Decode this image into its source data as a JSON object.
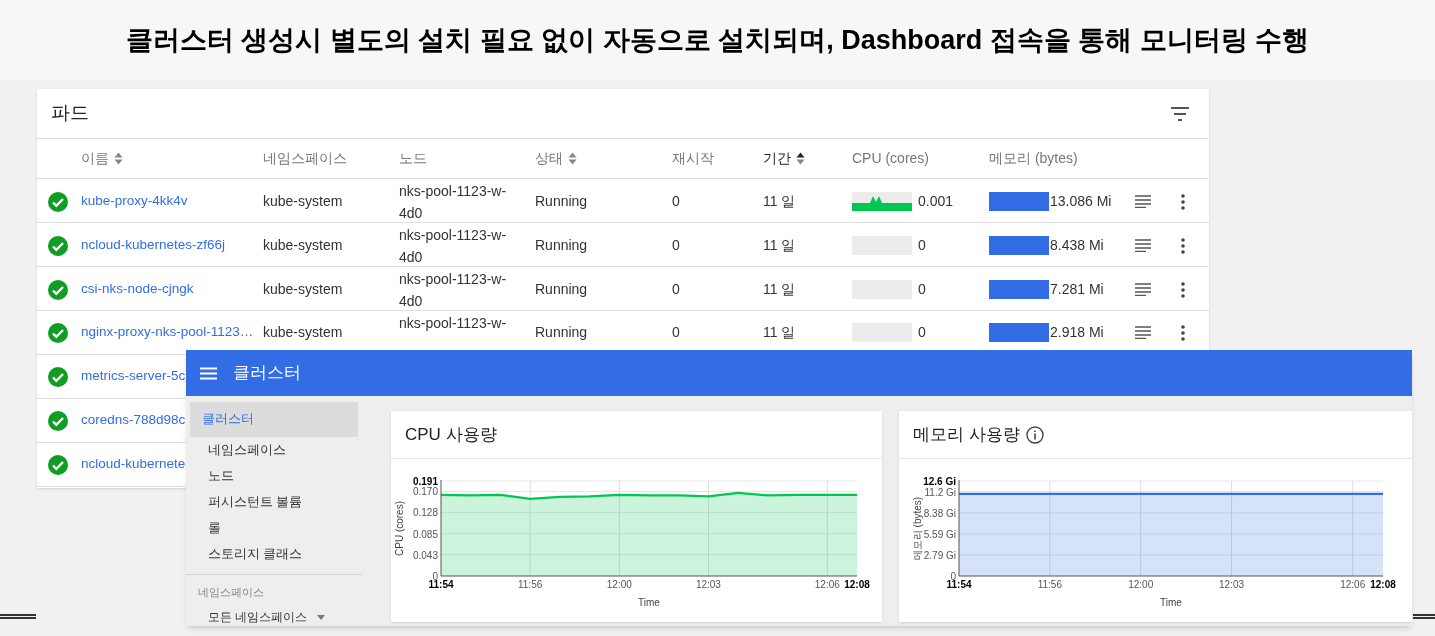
{
  "slide_title": "클러스터 생성시 별도의 설치 필요 없이 자동으로 설치되며, Dashboard 접속을 통해 모니터링 수행",
  "pods": {
    "title": "파드",
    "columns": [
      {
        "label": "이름",
        "sortable": true,
        "sorted": false
      },
      {
        "label": "네임스페이스"
      },
      {
        "label": "노드"
      },
      {
        "label": "상태",
        "sortable": true,
        "sorted": false
      },
      {
        "label": "재시작"
      },
      {
        "label": "기간",
        "sortable": true,
        "sorted": true
      },
      {
        "label": "CPU (cores)"
      },
      {
        "label": "메모리 (bytes)"
      }
    ],
    "rows": [
      {
        "healthy": true,
        "name": "kube-proxy-4kk4v",
        "namespace": "kube-system",
        "node": "nks-pool-1123-w-4d0",
        "status": "Running",
        "restarts": "0",
        "age": "11 일",
        "cpu_active": true,
        "cpu": "0.001",
        "memory": "13.086 Mi"
      },
      {
        "healthy": true,
        "name": "ncloud-kubernetes-zf66j",
        "namespace": "kube-system",
        "node": "nks-pool-1123-w-4d0",
        "status": "Running",
        "restarts": "0",
        "age": "11 일",
        "cpu_active": false,
        "cpu": "0",
        "memory": "8.438 Mi"
      },
      {
        "healthy": true,
        "name": "csi-nks-node-cjngk",
        "namespace": "kube-system",
        "node": "nks-pool-1123-w-4d0",
        "status": "Running",
        "restarts": "0",
        "age": "11 일",
        "cpu_active": false,
        "cpu": "0",
        "memory": "7.281 Mi"
      },
      {
        "healthy": true,
        "name": "nginx-proxy-nks-pool-1123…",
        "namespace": "kube-system",
        "node": "nks-pool-1123-w-",
        "status": "Running",
        "restarts": "0",
        "age": "11 일",
        "cpu_active": false,
        "cpu": "0",
        "memory": "2.918 Mi"
      },
      {
        "healthy": true,
        "name": "metrics-server-5c"
      },
      {
        "healthy": true,
        "name": "coredns-788d98c"
      },
      {
        "healthy": true,
        "name": "ncloud-kubernete"
      }
    ]
  },
  "dashboard": {
    "title": "클러스터",
    "sidebar": {
      "items": [
        {
          "label": "클러스터",
          "selected": true,
          "children": [
            {
              "label": "네임스페이스",
              "selected": false
            },
            {
              "label": "노드",
              "selected": false
            },
            {
              "label": "퍼시스턴트 볼륨",
              "selected": false
            },
            {
              "label": "롤",
              "selected": false
            },
            {
              "label": "스토리지 클래스",
              "selected": false
            }
          ]
        }
      ],
      "section": "네임스페이스",
      "namespace_select": "모든 네임스페이스"
    },
    "cards": [
      {
        "chart_data": {
          "type": "area",
          "title": "CPU 사용량",
          "xlabel": "Time",
          "ylabel": "CPU (cores)",
          "categories": [
            "11:54",
            null,
            null,
            "11:56",
            null,
            null,
            "12:00",
            null,
            null,
            "12:03",
            null,
            null,
            null,
            "12:06",
            "12:08"
          ],
          "grid": true,
          "series": [
            {
              "color": "#00c752",
              "values": [
                0.163,
                0.162,
                0.163,
                0.155,
                0.159,
                0.16,
                0.163,
                0.162,
                0.162,
                0.16,
                0.167,
                0.162,
                0.163,
                0.163,
                0.163
              ]
            }
          ],
          "ylim": [
            0,
            0.191
          ],
          "yticks": [
            {
              "value": 0,
              "label": "0"
            },
            {
              "value": 0.043,
              "label": "0.043"
            },
            {
              "value": 0.085,
              "label": "0.085"
            },
            {
              "value": 0.128,
              "label": "0.128"
            },
            {
              "value": 0.17,
              "label": "0.170"
            },
            {
              "value": 0.191,
              "label": "0.191"
            }
          ]
        }
      },
      {
        "info": true,
        "chart_data": {
          "type": "area",
          "title": "메모리 사용량",
          "xlabel": "Time",
          "ylabel": "메모리 (bytes)",
          "categories": [
            "11:54",
            null,
            null,
            "11:56",
            null,
            null,
            "12:00",
            null,
            null,
            "12:03",
            null,
            null,
            null,
            "12:06",
            "12:08"
          ],
          "grid": true,
          "series": [
            {
              "color": "#326de6",
              "values": [
                10.9,
                10.9,
                10.9,
                10.9,
                10.9,
                10.9,
                10.9,
                10.9,
                10.9,
                10.9,
                10.9,
                10.9,
                10.9,
                10.9,
                10.9
              ]
            }
          ],
          "ylim": [
            0,
            12.6
          ],
          "yticks": [
            {
              "value": 0,
              "label": "0"
            },
            {
              "value": 2.79,
              "label": "2.79 Gi"
            },
            {
              "value": 5.59,
              "label": "5.59 Gi"
            },
            {
              "value": 8.38,
              "label": "8.38 Gi"
            },
            {
              "value": 11.2,
              "label": "11.2 Gi"
            },
            {
              "value": 12.6,
              "label": "12.6 Gi"
            }
          ]
        }
      }
    ]
  }
}
